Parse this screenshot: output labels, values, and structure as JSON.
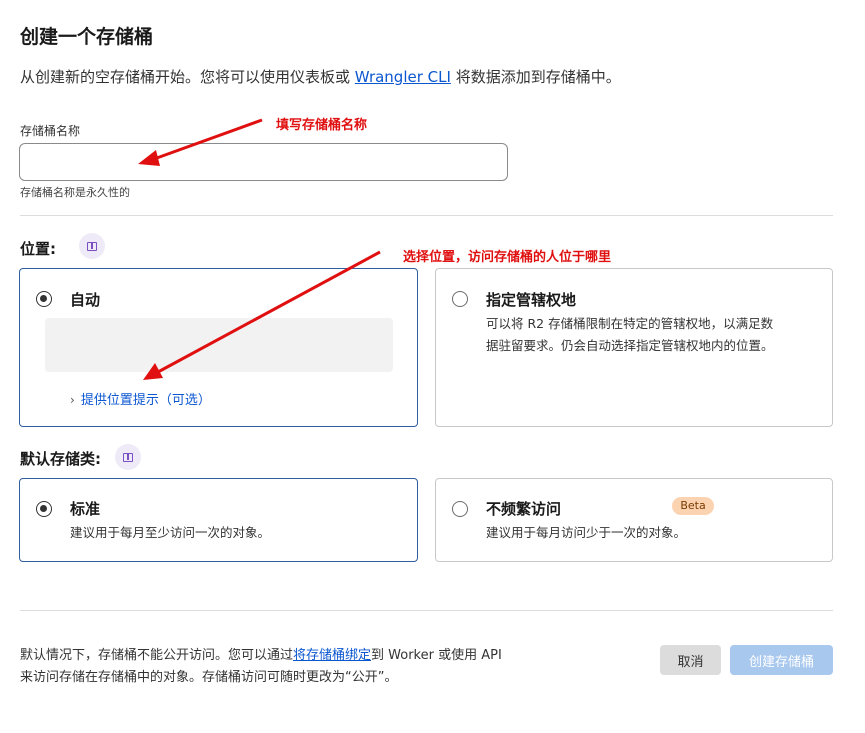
{
  "header": {
    "title": "创建一个存储桶",
    "intro_prefix": "从创建新的空存储桶开始。您将可以使用仪表板或 ",
    "intro_link": "Wrangler CLI",
    "intro_suffix": " 将数据添加到存储桶中。"
  },
  "bucket_name": {
    "label": "存储桶名称",
    "value": "",
    "hint": "存储桶名称是永久性的"
  },
  "location": {
    "title": "位置:",
    "options": [
      {
        "title": "自动",
        "selected": true,
        "hint_link": "提供位置提示（可选）"
      },
      {
        "title": "指定管辖权地",
        "selected": false,
        "description_line1": "可以将 R2 存储桶限制在特定的管辖权地，以满足数",
        "description_line2": "据驻留要求。仍会自动选择指定管辖权地内的位置。"
      }
    ]
  },
  "storage_class": {
    "title": "默认存储类:",
    "options": [
      {
        "title": "标准",
        "selected": true,
        "description": "建议用于每月至少访问一次的对象。"
      },
      {
        "title": "不频繁访问",
        "selected": false,
        "badge": "Beta",
        "description": "建议用于每月访问少于一次的对象。"
      }
    ]
  },
  "footer": {
    "text_prefix": "默认情况下，存储桶不能公开访问。您可以通过",
    "text_link": "将存储桶绑定",
    "text_suffix": "到 Worker 或使用 API",
    "text_line2": "来访问存储在存储桶中的对象。存储桶访问可随时更改为“公开”。",
    "cancel_label": "取消",
    "create_label": "创建存储桶"
  },
  "annotations": {
    "name_note": "填写存储桶名称",
    "location_note": "选择位置，访问存储桶的人位于哪里"
  },
  "colors": {
    "accent_link": "#0b57d0",
    "annotation_red": "#e01010",
    "selected_border": "#2f5f9e",
    "create_button_disabled": "#a8c8ee"
  }
}
